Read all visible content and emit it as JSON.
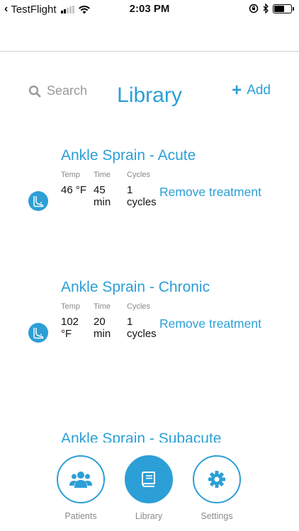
{
  "status_bar": {
    "back_app": "TestFlight",
    "time": "2:03 PM",
    "battery_level": 0.55,
    "icons": [
      "back-chevron-icon",
      "signal-icon",
      "wifi-icon",
      "rotation-lock-icon",
      "bluetooth-icon",
      "battery-icon"
    ]
  },
  "header": {
    "search_label": "Search",
    "title": "Library",
    "add_label": "Add"
  },
  "list": {
    "columns": {
      "temp": "Temp",
      "time": "Time",
      "cycles": "Cycles"
    },
    "remove_label": "Remove treatment",
    "items": [
      {
        "name": "Ankle Sprain - Acute",
        "temp": "46 °F",
        "time": "45 min",
        "cycles": "1 cycles",
        "icon": "foot-icon"
      },
      {
        "name": "Ankle Sprain - Chronic",
        "temp": "102 °F",
        "time": "20 min",
        "cycles": "1 cycles",
        "icon": "foot-icon"
      },
      {
        "name": "Ankle Sprain - Subacute"
      }
    ]
  },
  "tabs": [
    {
      "label": "Patients",
      "icon": "users-icon",
      "active": false
    },
    {
      "label": "Library",
      "icon": "book-icon",
      "active": true
    },
    {
      "label": "Settings",
      "icon": "gear-icon",
      "active": false
    }
  ],
  "colors": {
    "accent": "#2b9fd6",
    "muted": "#888888"
  }
}
